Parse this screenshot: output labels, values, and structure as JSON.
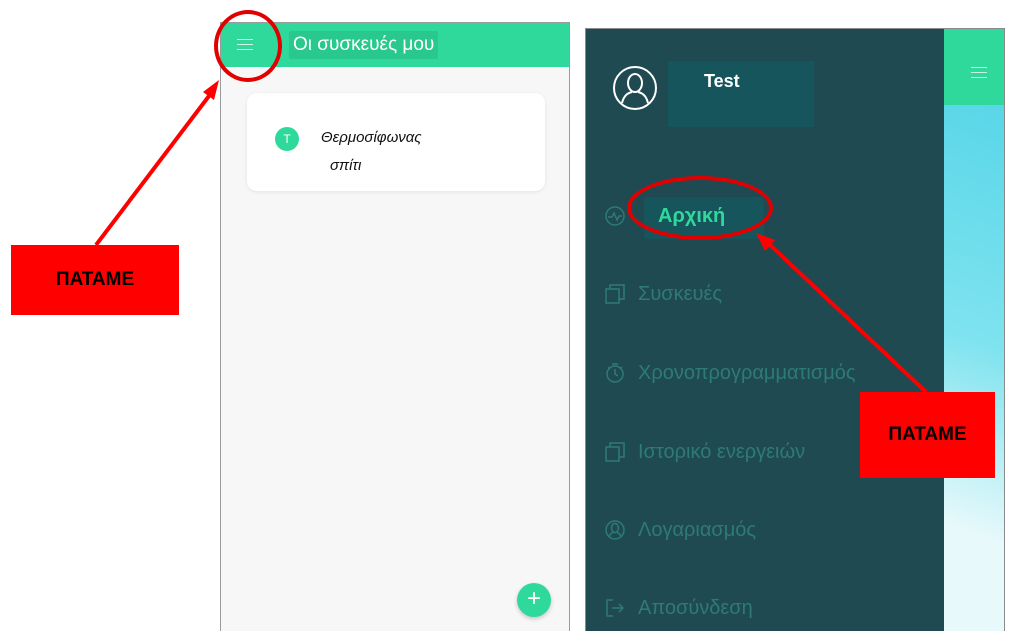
{
  "left_screen": {
    "title": "Οι συσκευές μου",
    "device": {
      "avatar_letter": "T",
      "name": "Θερμοσίφωνας",
      "subtitle": "σπίτι"
    },
    "fab_icon": "+"
  },
  "right_screen": {
    "user": {
      "name": "Test"
    },
    "menu": [
      {
        "label": "Αρχική",
        "icon": "activity-icon"
      },
      {
        "label": "Συσκευές",
        "icon": "copy-icon"
      },
      {
        "label": "Χρονοπρογραμματισμός",
        "icon": "stopwatch-icon"
      },
      {
        "label": "Ιστορικό ενεργειών",
        "icon": "copy-icon"
      },
      {
        "label": "Λογαριασμός",
        "icon": "user-icon"
      },
      {
        "label": "Αποσύνδεση",
        "icon": "logout-icon"
      }
    ]
  },
  "annotations": {
    "left_callout": "ΠΑΤΑΜΕ",
    "right_callout": "ΠΑΤΑΜΕ",
    "color": "#ff0000"
  },
  "colors": {
    "brand_green": "#2fd99b",
    "drawer_bg": "#1f4a52",
    "menu_text": "#2e7a79"
  }
}
